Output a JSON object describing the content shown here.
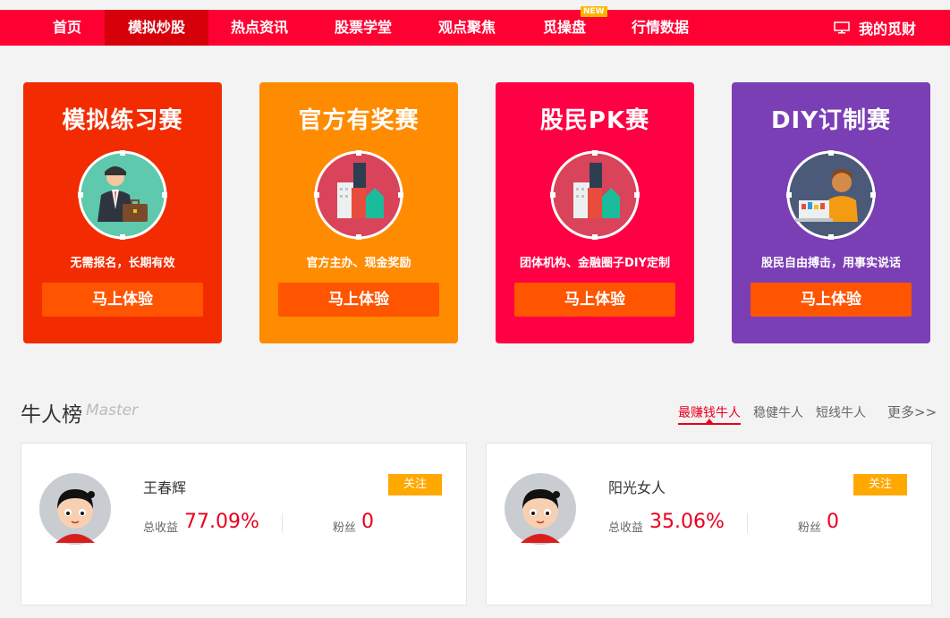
{
  "nav": {
    "items": [
      {
        "label": "首页"
      },
      {
        "label": "模拟炒股"
      },
      {
        "label": "热点资讯"
      },
      {
        "label": "股票学堂"
      },
      {
        "label": "观点聚焦"
      },
      {
        "label": "觅操盘"
      },
      {
        "label": "行情数据"
      }
    ],
    "active_index": 1,
    "new_badge": "NEW",
    "my_label": "我的觅财",
    "my_icon": "monitor-icon"
  },
  "cards": [
    {
      "title": "模拟练习赛",
      "desc": "无需报名，长期有效",
      "button": "马上体验",
      "color": "#f22c00",
      "icon": "businessman-icon"
    },
    {
      "title": "官方有奖赛",
      "desc": "官方主办、现金奖励",
      "button": "马上体验",
      "color": "#ff8c00",
      "icon": "city-buildings-icon"
    },
    {
      "title": "股民PK赛",
      "desc": "团体机构、金融圈子DIY定制",
      "button": "马上体验",
      "color": "#ff0044",
      "icon": "city-buildings-icon"
    },
    {
      "title": "DIY订制赛",
      "desc": "股民自由搏击，用事实说话",
      "button": "马上体验",
      "color": "#7b3fb5",
      "icon": "trader-icon"
    }
  ],
  "master": {
    "title": "牛人榜",
    "subtitle": "Master",
    "tabs": [
      "最赚钱牛人",
      "稳健牛人",
      "短线牛人"
    ],
    "active_tab": 0,
    "more": "更多>>",
    "people": [
      {
        "name": "王春辉",
        "follow": "关注",
        "return_label": "总收益",
        "return_value": "77.09%",
        "fans_label": "粉丝",
        "fans_value": "0"
      },
      {
        "name": "阳光女人",
        "follow": "关注",
        "return_label": "总收益",
        "return_value": "35.06%",
        "fans_label": "粉丝",
        "fans_value": "0"
      }
    ]
  },
  "colors": {
    "nav_bg": "#ff0033",
    "nav_active": "#d6000b",
    "button": "#ff5400",
    "accent": "#e8001c",
    "follow": "#ffa800"
  }
}
